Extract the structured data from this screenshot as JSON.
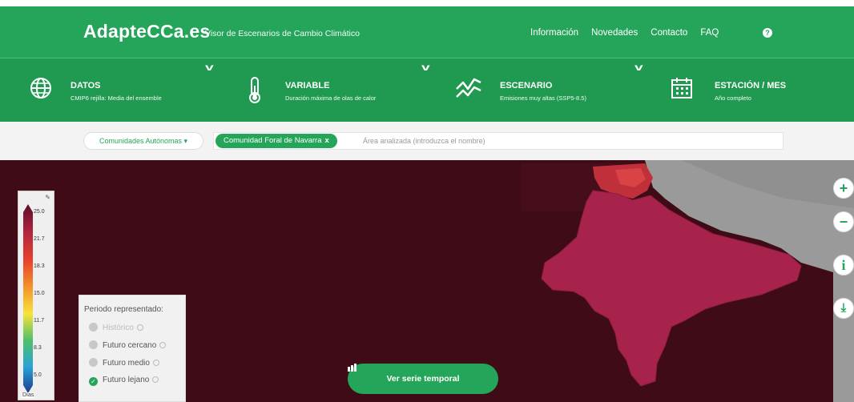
{
  "header": {
    "brand": "AdapteCCa.es",
    "tagline": "Visor de Escenarios de Cambio Climático",
    "nav": [
      "Información",
      "Novedades",
      "Contacto",
      "FAQ"
    ],
    "help_glyph": "?"
  },
  "selectors": [
    {
      "label": "DATOS",
      "value": "CMIP6 rejilla: Media del ensemble",
      "icon": "globe-icon"
    },
    {
      "label": "VARIABLE",
      "value": "Duración máxima de olas de calor",
      "icon": "thermometer-icon"
    },
    {
      "label": "ESCENARIO",
      "value": "Emisiones muy altas (SSP5-8.5)",
      "icon": "trend-icon"
    },
    {
      "label": "ESTACIÓN / MES",
      "value": "Año completo",
      "icon": "calendar-icon"
    }
  ],
  "search": {
    "region_type": "Comunidades Autónomas ▾",
    "selected_chip": "Comunidad Foral de Navarra",
    "chip_remove": "x",
    "placeholder": "Área analizada (introduzca el nombre)"
  },
  "legend": {
    "ticks": [
      "25.0",
      "21.7",
      "18.3",
      "15.0",
      "11.7",
      "8.3",
      "5.0"
    ],
    "unit": "Días",
    "edit_glyph": "✎"
  },
  "period_panel": {
    "title": "Periodo representado:",
    "options": [
      {
        "label": "Histórico",
        "selected": false,
        "disabled": true
      },
      {
        "label": "Futuro cercano",
        "selected": false,
        "disabled": false
      },
      {
        "label": "Futuro medio",
        "selected": false,
        "disabled": false
      },
      {
        "label": "Futuro lejano",
        "selected": true,
        "disabled": false
      }
    ]
  },
  "map_buttons": [
    "+",
    "−",
    "i",
    "⤓"
  ],
  "series_button": {
    "label": "Ver serie temporal",
    "icon": "chart-icon"
  },
  "colors": {
    "brand_green": "#25a55a",
    "map_background": "#3e0b17",
    "region_fill": "#a8234c",
    "outside_fill": "#9a9a9a"
  }
}
